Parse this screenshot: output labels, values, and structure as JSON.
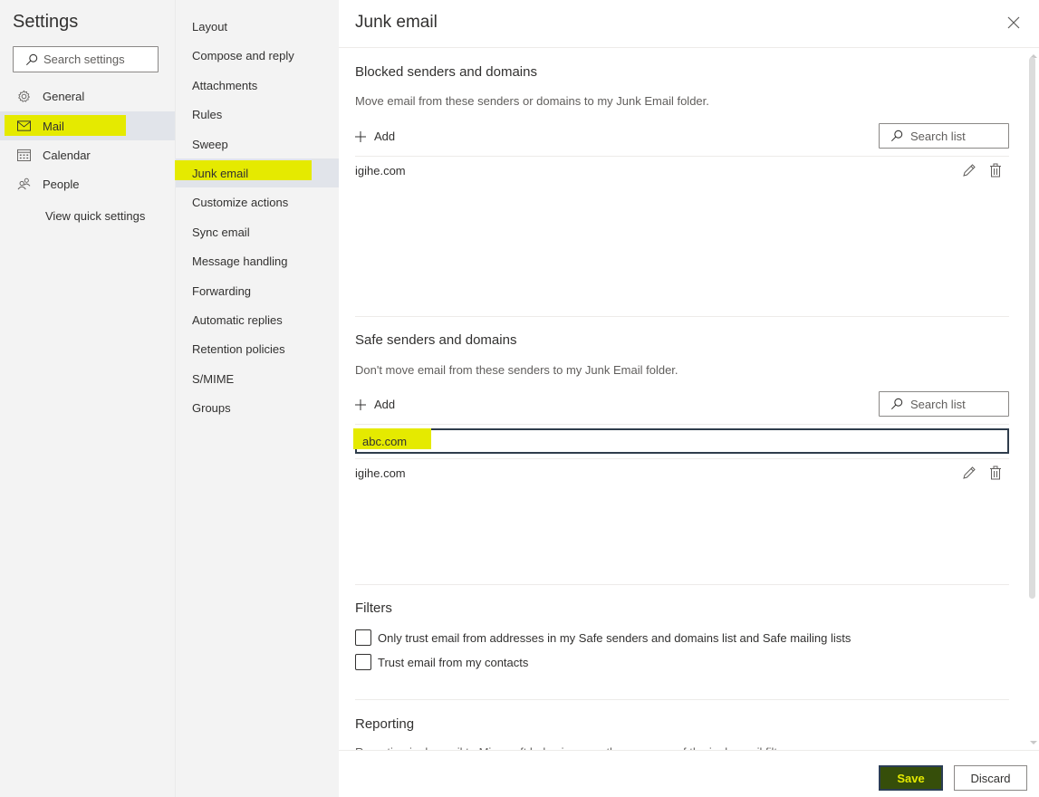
{
  "settings": {
    "title": "Settings",
    "search_placeholder": "Search settings",
    "nav": [
      {
        "label": "General",
        "icon": "gear-icon",
        "active": false
      },
      {
        "label": "Mail",
        "icon": "mail-icon",
        "active": true
      },
      {
        "label": "Calendar",
        "icon": "calendar-icon",
        "active": false
      },
      {
        "label": "People",
        "icon": "people-icon",
        "active": false
      }
    ],
    "quick_settings_label": "View quick settings"
  },
  "mail_nav": {
    "items": [
      {
        "label": "Layout"
      },
      {
        "label": "Compose and reply"
      },
      {
        "label": "Attachments"
      },
      {
        "label": "Rules"
      },
      {
        "label": "Sweep"
      },
      {
        "label": "Junk email",
        "active": true
      },
      {
        "label": "Customize actions"
      },
      {
        "label": "Sync email"
      },
      {
        "label": "Message handling"
      },
      {
        "label": "Forwarding"
      },
      {
        "label": "Automatic replies"
      },
      {
        "label": "Retention policies"
      },
      {
        "label": "S/MIME"
      },
      {
        "label": "Groups"
      }
    ]
  },
  "panel": {
    "title": "Junk email",
    "blocked": {
      "title": "Blocked senders and domains",
      "description": "Move email from these senders or domains to my Junk Email folder.",
      "add_label": "Add",
      "search_placeholder": "Search list",
      "entries": [
        "igihe.com"
      ]
    },
    "safe": {
      "title": "Safe senders and domains",
      "description": "Don't move email from these senders to my Junk Email folder.",
      "add_label": "Add",
      "search_placeholder": "Search list",
      "new_entry_value": "abc.com",
      "entries": [
        "igihe.com"
      ]
    },
    "filters": {
      "title": "Filters",
      "options": [
        {
          "label": "Only trust email from addresses in my Safe senders and domains list and Safe mailing lists",
          "checked": false
        },
        {
          "label": "Trust email from my contacts",
          "checked": false
        }
      ]
    },
    "reporting": {
      "title": "Reporting",
      "description": "Reporting junk email to Microsoft helps improve the accuracy of the junk email filter."
    },
    "save_label": "Save",
    "discard_label": "Discard"
  },
  "colors": {
    "highlight": "#e5ea00",
    "active_nav_bg": "#e1e4ea",
    "save_bg": "#364e0a",
    "save_text": "#e5ea00"
  }
}
